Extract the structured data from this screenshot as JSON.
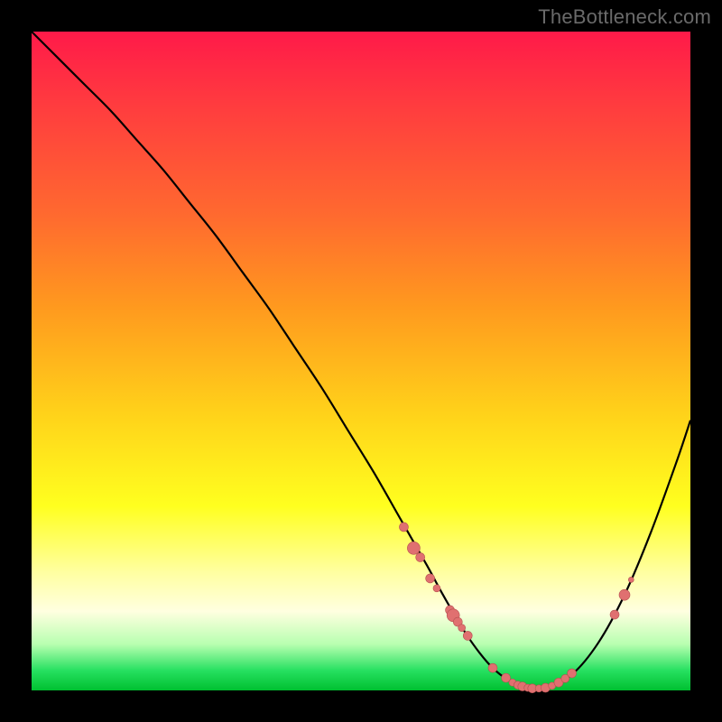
{
  "watermark": "TheBottleneck.com",
  "colors": {
    "frame_bg": "#000000",
    "curve": "#000000",
    "marker_fill": "#e07070",
    "marker_stroke": "#b55050"
  },
  "chart_data": {
    "type": "line",
    "title": "",
    "xlabel": "",
    "ylabel": "",
    "xlim": [
      0,
      100
    ],
    "ylim": [
      0,
      100
    ],
    "grid": false,
    "legend": false,
    "series": [
      {
        "name": "bottleneck-curve",
        "x": [
          0,
          4,
          8,
          12,
          16,
          20,
          24,
          28,
          32,
          36,
          40,
          44,
          48,
          52,
          56,
          60,
          62,
          64,
          66,
          68,
          70,
          72,
          74,
          76,
          78,
          82,
          86,
          90,
          94,
          98,
          100
        ],
        "y": [
          100,
          96,
          92,
          88,
          83.5,
          79,
          74,
          69,
          63.5,
          58,
          52,
          46,
          39.5,
          33,
          26,
          19,
          15.3,
          11.8,
          8.5,
          5.7,
          3.4,
          1.8,
          0.8,
          0.3,
          0.4,
          2.4,
          7.2,
          14.5,
          24,
          35,
          41
        ]
      }
    ],
    "markers": [
      {
        "x": 56.5,
        "y": 24.8,
        "r": 5
      },
      {
        "x": 58.0,
        "y": 21.6,
        "r": 7
      },
      {
        "x": 59.0,
        "y": 20.2,
        "r": 5
      },
      {
        "x": 60.5,
        "y": 17.0,
        "r": 5
      },
      {
        "x": 61.5,
        "y": 15.5,
        "r": 4
      },
      {
        "x": 63.5,
        "y": 12.2,
        "r": 5
      },
      {
        "x": 64.0,
        "y": 11.4,
        "r": 7
      },
      {
        "x": 64.7,
        "y": 10.4,
        "r": 5
      },
      {
        "x": 65.3,
        "y": 9.5,
        "r": 4
      },
      {
        "x": 66.2,
        "y": 8.3,
        "r": 5
      },
      {
        "x": 70.0,
        "y": 3.4,
        "r": 5
      },
      {
        "x": 72.0,
        "y": 1.9,
        "r": 5
      },
      {
        "x": 73.0,
        "y": 1.2,
        "r": 4
      },
      {
        "x": 73.8,
        "y": 0.8,
        "r": 4.5
      },
      {
        "x": 74.5,
        "y": 0.6,
        "r": 5
      },
      {
        "x": 75.3,
        "y": 0.4,
        "r": 4
      },
      {
        "x": 76.0,
        "y": 0.3,
        "r": 5
      },
      {
        "x": 77.0,
        "y": 0.3,
        "r": 4
      },
      {
        "x": 78.0,
        "y": 0.4,
        "r": 5
      },
      {
        "x": 79.0,
        "y": 0.7,
        "r": 4
      },
      {
        "x": 80.0,
        "y": 1.2,
        "r": 5
      },
      {
        "x": 81.0,
        "y": 1.8,
        "r": 4.5
      },
      {
        "x": 82.0,
        "y": 2.6,
        "r": 5
      },
      {
        "x": 88.5,
        "y": 11.5,
        "r": 5
      },
      {
        "x": 90.0,
        "y": 14.5,
        "r": 6
      },
      {
        "x": 91.0,
        "y": 16.8,
        "r": 3
      }
    ]
  }
}
